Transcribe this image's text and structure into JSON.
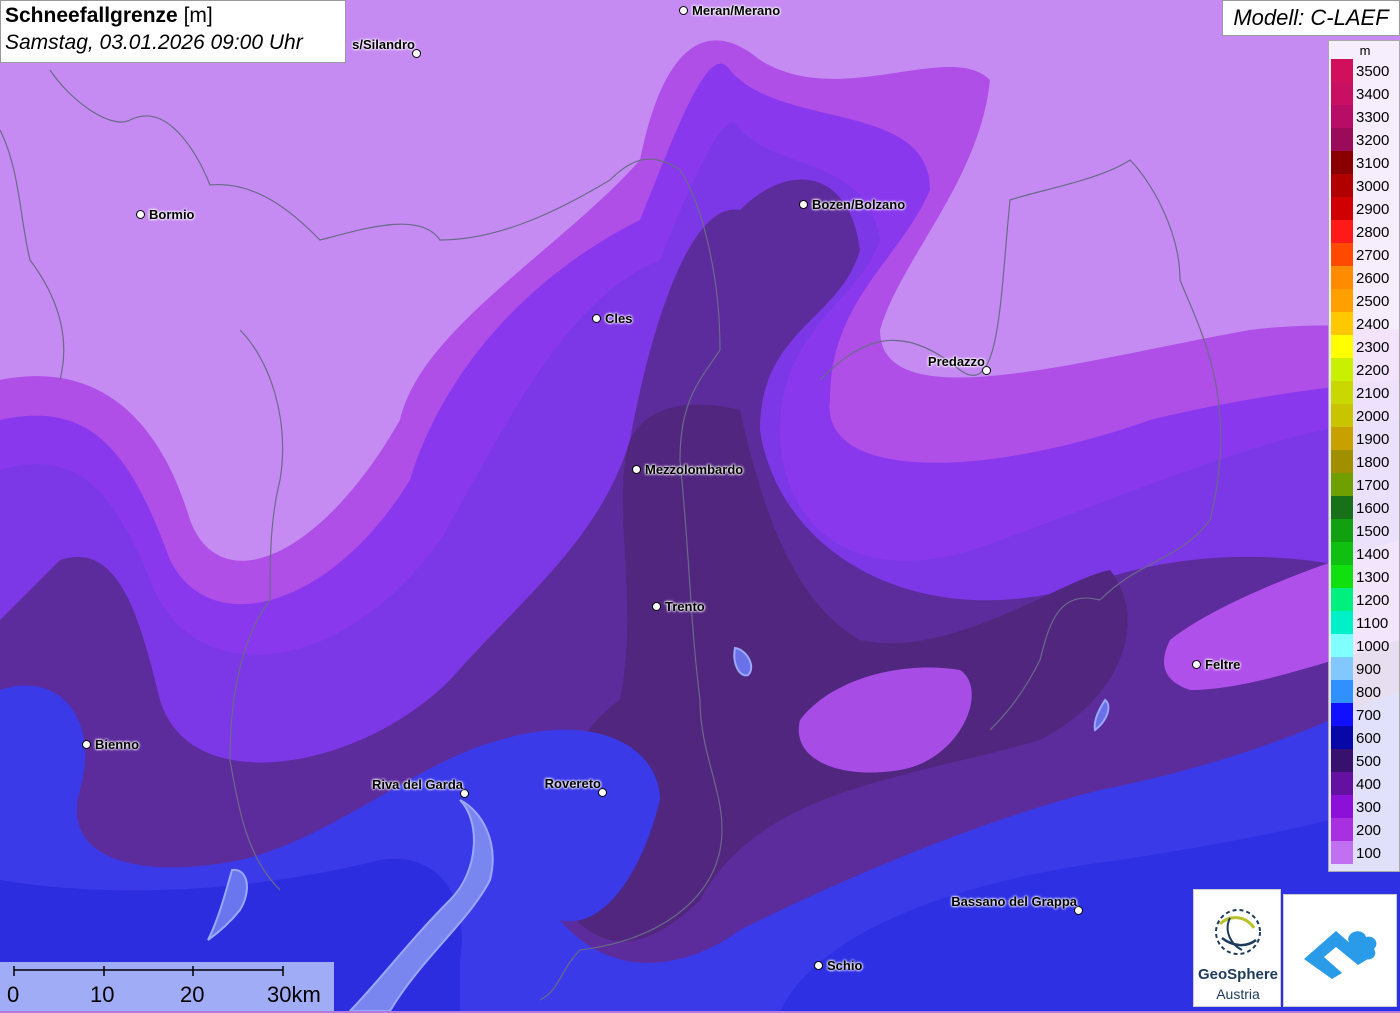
{
  "title": {
    "main": "Schneefallgrenze",
    "unit": "[m]",
    "datetime": "Samstag, 03.01.2026 09:00 Uhr"
  },
  "model": "Modell: C-LAEF",
  "legend": {
    "unit": "m",
    "levels": [
      {
        "label": "3500",
        "color": "#d0105a"
      },
      {
        "label": "3400",
        "color": "#c80f62"
      },
      {
        "label": "3300",
        "color": "#b80d66"
      },
      {
        "label": "3200",
        "color": "#9a0c5a"
      },
      {
        "label": "3100",
        "color": "#8a0000"
      },
      {
        "label": "3000",
        "color": "#b00000"
      },
      {
        "label": "2900",
        "color": "#d00000"
      },
      {
        "label": "2800",
        "color": "#ff1a1a"
      },
      {
        "label": "2700",
        "color": "#ff4a00"
      },
      {
        "label": "2600",
        "color": "#ff8c00"
      },
      {
        "label": "2500",
        "color": "#ffa000"
      },
      {
        "label": "2400",
        "color": "#ffc800"
      },
      {
        "label": "2300",
        "color": "#ffff00"
      },
      {
        "label": "2200",
        "color": "#c8f000"
      },
      {
        "label": "2100",
        "color": "#c8d800"
      },
      {
        "label": "2000",
        "color": "#c8c400"
      },
      {
        "label": "1900",
        "color": "#c8a000"
      },
      {
        "label": "1800",
        "color": "#a09000"
      },
      {
        "label": "1700",
        "color": "#70a000"
      },
      {
        "label": "1600",
        "color": "#187018"
      },
      {
        "label": "1500",
        "color": "#10a010"
      },
      {
        "label": "1400",
        "color": "#10c010"
      },
      {
        "label": "1300",
        "color": "#10e010"
      },
      {
        "label": "1200",
        "color": "#00f080"
      },
      {
        "label": "1100",
        "color": "#00f0c8"
      },
      {
        "label": "1000",
        "color": "#80ffff"
      },
      {
        "label": "900",
        "color": "#80c8ff"
      },
      {
        "label": "800",
        "color": "#3090ff"
      },
      {
        "label": "700",
        "color": "#1010ff"
      },
      {
        "label": "600",
        "color": "#0808a8"
      },
      {
        "label": "500",
        "color": "#38106e"
      },
      {
        "label": "400",
        "color": "#6410a0"
      },
      {
        "label": "300",
        "color": "#8c10d8"
      },
      {
        "label": "200",
        "color": "#a830e0"
      },
      {
        "label": "100",
        "color": "#c070f0"
      }
    ]
  },
  "cities": [
    {
      "name": "Meran/Merano"
    },
    {
      "name": "s/Silandro"
    },
    {
      "name": "Bormio"
    },
    {
      "name": "Bozen/Bolzano"
    },
    {
      "name": "Cles"
    },
    {
      "name": "Predazzo"
    },
    {
      "name": "Mezzolombardo"
    },
    {
      "name": "Trento"
    },
    {
      "name": "Feltre"
    },
    {
      "name": "Bienno"
    },
    {
      "name": "Riva del Garda"
    },
    {
      "name": "Rovereto"
    },
    {
      "name": "Bassano del Grappa"
    },
    {
      "name": "Schio"
    }
  ],
  "scalebar": {
    "labels": [
      "0",
      "10",
      "20",
      "30km"
    ]
  },
  "logos": {
    "geosphere_line1": "GeoSphere",
    "geosphere_line2": "Austria"
  }
}
